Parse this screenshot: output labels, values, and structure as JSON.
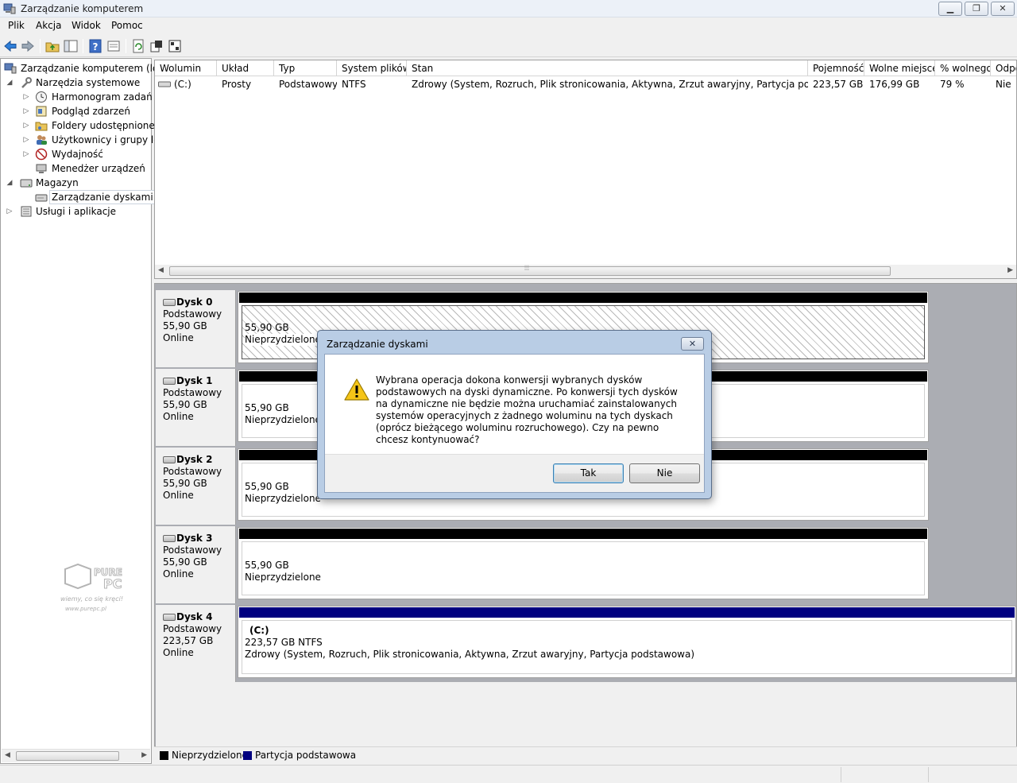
{
  "window": {
    "title": "Zarządzanie komputerem",
    "controls": {
      "minimize": "▁",
      "maximize": "❐",
      "close": "✕"
    }
  },
  "menu": [
    "Plik",
    "Akcja",
    "Widok",
    "Pomoc"
  ],
  "toolbar_icons": [
    "back-arrow-icon",
    "forward-arrow-icon",
    "up-folder-icon",
    "show-hide-tree-icon",
    "help-icon",
    "properties-view-icon",
    "refresh-icon",
    "export-icon",
    "settings-icon"
  ],
  "tree": {
    "root": "Zarządzanie komputerem (lokalne)",
    "system_tools": "Narzędzia systemowe",
    "task_scheduler": "Harmonogram zadań",
    "event_viewer": "Podgląd zdarzeń",
    "shared_folders": "Foldery udostępnione",
    "local_users": "Użytkownicy i grupy lokalne",
    "performance": "Wydajność",
    "device_manager": "Menedżer urządzeń",
    "storage": "Magazyn",
    "disk_management": "Zarządzanie dyskami",
    "services": "Usługi i aplikacje"
  },
  "volumes": {
    "columns": [
      "Wolumin",
      "Układ",
      "Typ",
      "System plików",
      "Stan",
      "Pojemność",
      "Wolne miejsce",
      "% wolnego",
      "Odporność na błędy"
    ],
    "rows": [
      {
        "volume": "(C:)",
        "layout": "Prosty",
        "type": "Podstawowy",
        "fs": "NTFS",
        "status": "Zdrowy (System, Rozruch, Plik stronicowania, Aktywna, Zrzut awaryjny, Partycja podstawowa)",
        "capacity": "223,57 GB",
        "free": "176,99 GB",
        "pct_free": "79 %",
        "fault": "Nie"
      }
    ]
  },
  "disks": [
    {
      "name": "Dysk 0",
      "type": "Podstawowy",
      "size": "55,90 GB",
      "status": "Online",
      "part_size": "55,90 GB",
      "part_state": "Nieprzydzielone"
    },
    {
      "name": "Dysk 1",
      "type": "Podstawowy",
      "size": "55,90 GB",
      "status": "Online",
      "part_size": "55,90 GB",
      "part_state": "Nieprzydzielone"
    },
    {
      "name": "Dysk 2",
      "type": "Podstawowy",
      "size": "55,90 GB",
      "status": "Online",
      "part_size": "55,90 GB",
      "part_state": "Nieprzydzielone"
    },
    {
      "name": "Dysk 3",
      "type": "Podstawowy",
      "size": "55,90 GB",
      "status": "Online",
      "part_size": "55,90 GB",
      "part_state": "Nieprzydzielone"
    },
    {
      "name": "Dysk 4",
      "type": "Podstawowy",
      "size": "223,57 GB",
      "status": "Online",
      "part_label": "(C:)",
      "part_size": "223,57 GB NTFS",
      "part_state": "Zdrowy (System, Rozruch, Plik stronicowania, Aktywna, Zrzut awaryjny, Partycja podstawowa)"
    }
  ],
  "legend": {
    "unallocated": "Nieprzydzielone",
    "primary": "Partycja podstawowa"
  },
  "colors": {
    "unallocated": "#000000",
    "primary_partition": "#000080"
  },
  "dialog": {
    "title": "Zarządzanie dyskami",
    "message": "Wybrana operacja dokona konwersji wybranych dysków podstawowych na dyski dynamiczne. Po konwersji tych dysków na dynamiczne nie będzie można uruchamiać zainstalowanych systemów operacyjnych z żadnego woluminu na tych dyskach (oprócz bieżącego woluminu rozruchowego). Czy na pewno chcesz kontynuować?",
    "yes": "Tak",
    "no": "Nie",
    "close": "✕",
    "icon": "warning-icon"
  },
  "watermark": {
    "brand": "PURE PC",
    "tagline": "wiemy, co się kręci!",
    "url": "www.purepc.pl"
  }
}
